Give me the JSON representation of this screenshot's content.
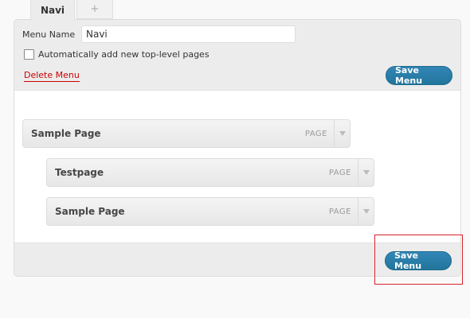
{
  "tabs": [
    {
      "label": "Navi"
    },
    {
      "label": "+"
    }
  ],
  "menu": {
    "name_label": "Menu Name",
    "name_value": "Navi",
    "auto_add_label": "Automatically add new top-level pages",
    "delete_label": "Delete Menu",
    "save_label": "Save Menu"
  },
  "items": [
    {
      "title": "Sample Page",
      "type": "PAGE"
    },
    {
      "title": "Testpage",
      "type": "PAGE"
    },
    {
      "title": "Sample Page",
      "type": "PAGE"
    }
  ],
  "footer": {
    "save_label": "Save Menu"
  },
  "colors": {
    "primary_button": "#21759b",
    "delete_link": "#cc0000",
    "highlight_border": "#d6242c"
  }
}
